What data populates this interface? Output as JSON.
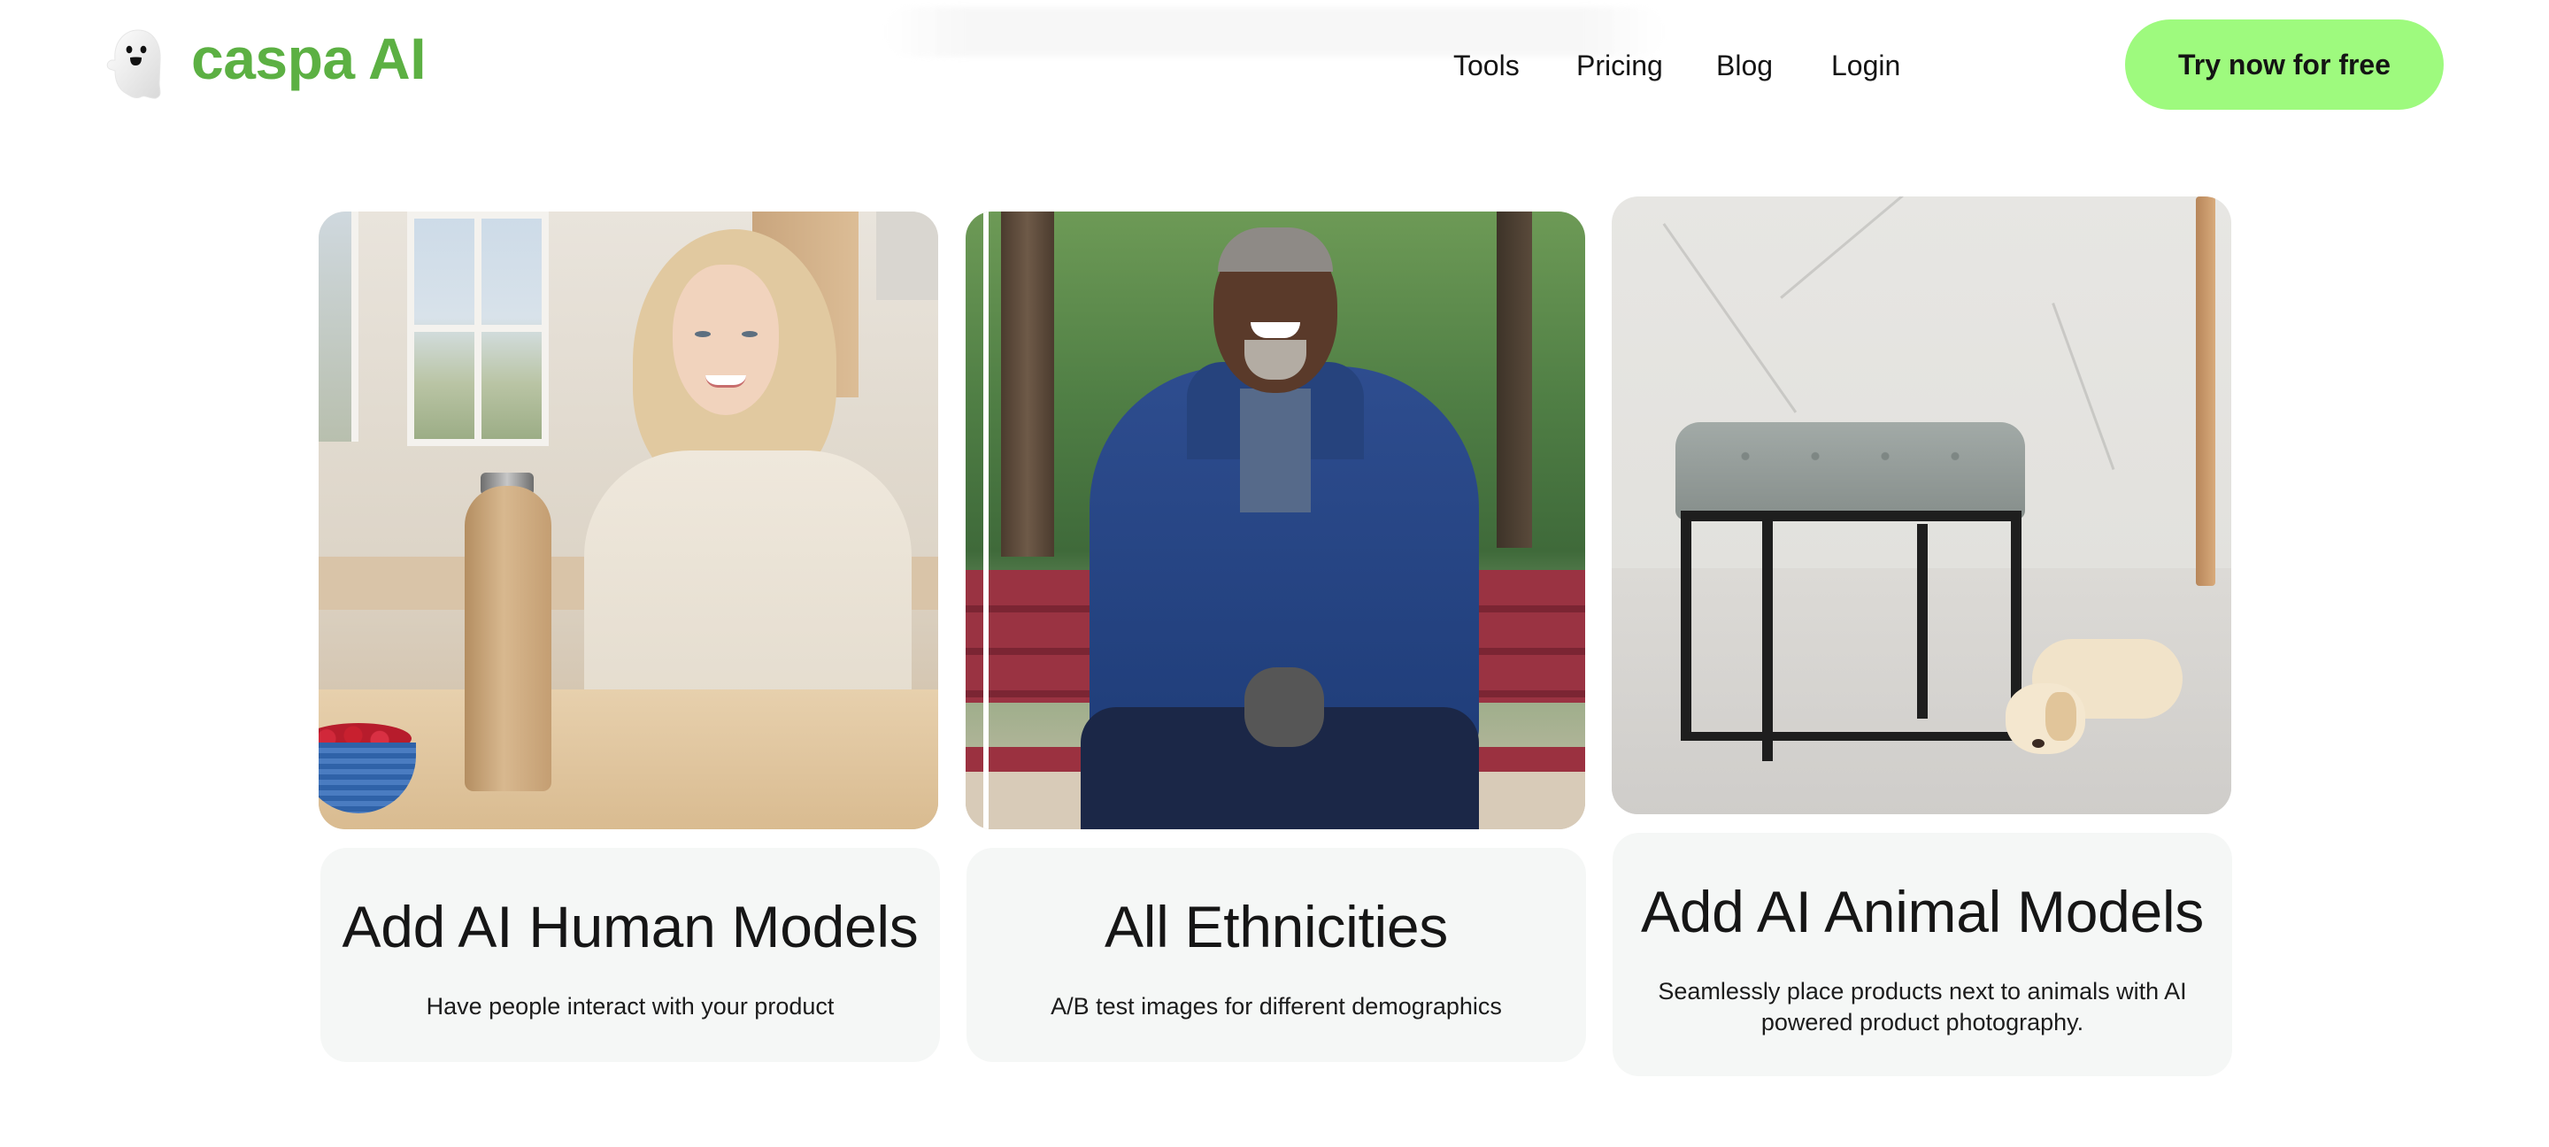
{
  "header": {
    "logo_icon": "ghost-icon",
    "logo_text": "caspa AI",
    "nav": [
      {
        "label": "Tools"
      },
      {
        "label": "Pricing"
      },
      {
        "label": "Blog"
      },
      {
        "label": "Login"
      }
    ],
    "cta_label": "Try now for free"
  },
  "colors": {
    "brand_green": "#5cb043",
    "cta_green": "#9efa7e",
    "card_background": "#f5f7f6",
    "text": "#161616"
  },
  "cards": [
    {
      "image_alt": "Smiling woman in a sunny kitchen next to a wooden water bottle and a bowl of berries",
      "title": "Add AI Human Models",
      "description": "Have people interact with your product"
    },
    {
      "image_alt": "Smiling man in a navy jacket sitting on a red park bench",
      "title": "All Ethnicities",
      "description": "A/B test images for different demographics"
    },
    {
      "image_alt": "Grey tufted ottoman with black metal frame in a marble room beside a sleeping puppy",
      "title": "Add AI Animal Models",
      "description": "Seamlessly place products next to animals with AI powered product photography."
    }
  ]
}
